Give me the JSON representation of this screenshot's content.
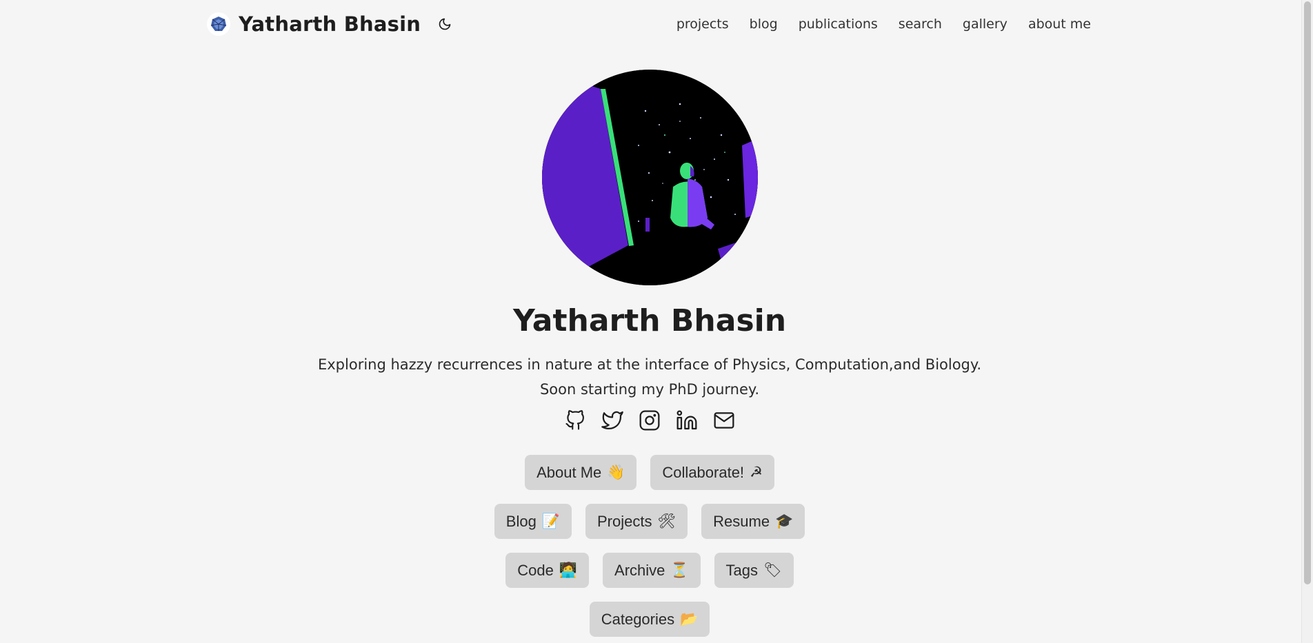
{
  "header": {
    "site_title": "Yatharth Bhasin",
    "nav": [
      {
        "label": "projects"
      },
      {
        "label": "blog"
      },
      {
        "label": "publications"
      },
      {
        "label": "search"
      },
      {
        "label": "gallery"
      },
      {
        "label": "about me"
      }
    ]
  },
  "profile": {
    "name": "Yatharth Bhasin",
    "tagline_line1": "Exploring hazzy recurrences in nature at the interface of Physics, Computation,and Biology.",
    "tagline_line2": "Soon starting my PhD journey."
  },
  "socials": [
    {
      "icon": "github-icon"
    },
    {
      "icon": "twitter-icon"
    },
    {
      "icon": "instagram-icon"
    },
    {
      "icon": "linkedin-icon"
    },
    {
      "icon": "email-icon"
    }
  ],
  "buttons": {
    "row1": [
      {
        "label": "About Me",
        "emoji": "👋"
      },
      {
        "label": "Collaborate!",
        "emoji": "☭"
      }
    ],
    "row2": [
      {
        "label": "Blog",
        "emoji": "📝"
      },
      {
        "label": "Projects",
        "emoji": "🛠"
      },
      {
        "label": "Resume",
        "emoji": "🎓"
      }
    ],
    "row3": [
      {
        "label": "Code",
        "emoji": "🧑‍💻"
      },
      {
        "label": "Archive",
        "emoji": "⏳"
      },
      {
        "label": "Tags",
        "emoji": "🏷"
      }
    ],
    "row4": [
      {
        "label": "Categories",
        "emoji": "📂"
      }
    ]
  },
  "colors": {
    "background": "#f5f5f5",
    "button_bg": "#d5d5d5",
    "avatar_accent_purple": "#5b1fc7",
    "avatar_accent_green": "#39e07a"
  }
}
